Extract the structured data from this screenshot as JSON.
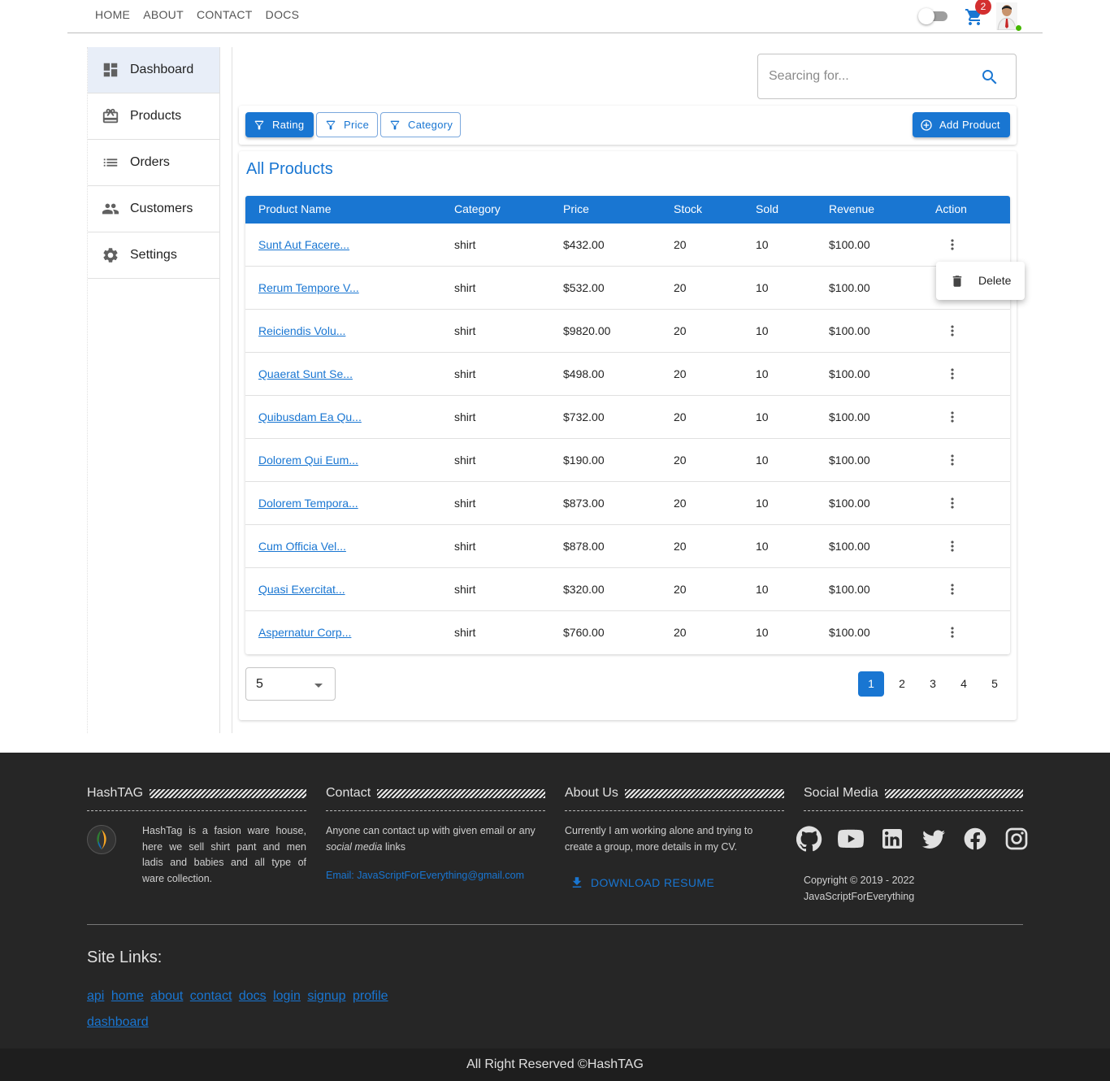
{
  "topnav": {
    "items": [
      "HOME",
      "ABOUT",
      "CONTACT",
      "DOCS"
    ],
    "cart_count": "2"
  },
  "sidebar": {
    "items": [
      {
        "label": "Dashboard",
        "icon": "dashboard-icon",
        "active": true
      },
      {
        "label": "Products",
        "icon": "card-giftcard-icon"
      },
      {
        "label": "Orders",
        "icon": "list-icon"
      },
      {
        "label": "Customers",
        "icon": "people-icon"
      },
      {
        "label": "Settings",
        "icon": "gear-icon"
      }
    ]
  },
  "search": {
    "placeholder": "Searcing for..."
  },
  "filters": {
    "rating": "Rating",
    "price": "Price",
    "category": "Category",
    "add_product": "Add Product"
  },
  "panel": {
    "title": "All Products"
  },
  "table": {
    "headers": [
      "Product Name",
      "Category",
      "Price",
      "Stock",
      "Sold",
      "Revenue",
      "Action"
    ],
    "rows": [
      [
        "Sunt Aut Facere...",
        "shirt",
        "$432.00",
        "20",
        "10",
        "$100.00"
      ],
      [
        "Rerum Tempore V...",
        "shirt",
        "$532.00",
        "20",
        "10",
        "$100.00"
      ],
      [
        "Reiciendis Volu...",
        "shirt",
        "$9820.00",
        "20",
        "10",
        "$100.00"
      ],
      [
        "Quaerat Sunt Se...",
        "shirt",
        "$498.00",
        "20",
        "10",
        "$100.00"
      ],
      [
        "Quibusdam Ea Qu...",
        "shirt",
        "$732.00",
        "20",
        "10",
        "$100.00"
      ],
      [
        "Dolorem Qui Eum...",
        "shirt",
        "$190.00",
        "20",
        "10",
        "$100.00"
      ],
      [
        "Dolorem Tempora...",
        "shirt",
        "$873.00",
        "20",
        "10",
        "$100.00"
      ],
      [
        "Cum Officia Vel...",
        "shirt",
        "$878.00",
        "20",
        "10",
        "$100.00"
      ],
      [
        "Quasi Exercitat...",
        "shirt",
        "$320.00",
        "20",
        "10",
        "$100.00"
      ],
      [
        "Aspernatur Corp...",
        "shirt",
        "$760.00",
        "20",
        "10",
        "$100.00"
      ]
    ]
  },
  "action_menu": {
    "delete_label": "Delete"
  },
  "rows_per_page": {
    "selected": "5"
  },
  "pagination": {
    "pages": [
      "1",
      "2",
      "3",
      "4",
      "5"
    ],
    "current": "1"
  },
  "footer": {
    "hashtag": {
      "title": "HashTAG",
      "text": "HashTag is a fasion ware house, here we sell shirt pant and men ladis and babies and all type of ware collection."
    },
    "contact": {
      "title": "Contact",
      "text_before": "Anyone can contact up with given email or any ",
      "text_em": "social media",
      "text_after": " links",
      "email": "Email: JavaScriptForEverything@gmail.com"
    },
    "about": {
      "title": "About Us",
      "text": "Currently I am working alone and trying to create a group, more details in my CV.",
      "download": "DOWNLOAD RESUME"
    },
    "social": {
      "title": "Social Media",
      "icons": [
        "github-icon",
        "youtube-icon",
        "linkedin-icon",
        "twitter-icon",
        "facebook-icon",
        "instagram-icon"
      ],
      "copyright_line1": "Copyright © 2019 - 2022",
      "copyright_line2": "JavaScriptForEverything"
    },
    "site_links_title": "Site Links:",
    "site_links": [
      "api",
      "home",
      "about",
      "contact",
      "docs",
      "login",
      "signup",
      "profile",
      "dashboard"
    ],
    "bottom": "All Right Reserved ©HashTAG"
  },
  "colors": {
    "primary": "#1976d2",
    "footer_bg": "#262626",
    "badge": "#d32f2f",
    "online": "#44b700"
  }
}
